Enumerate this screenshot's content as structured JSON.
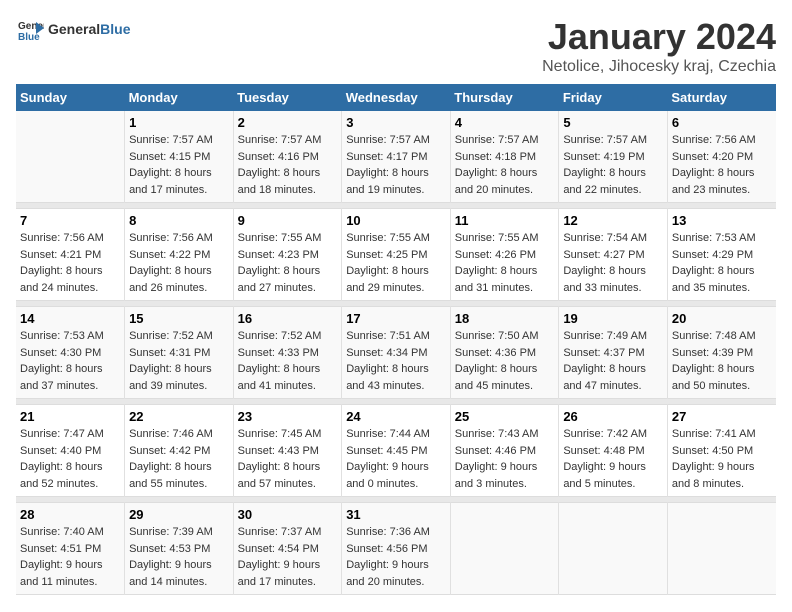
{
  "header": {
    "logo_general": "General",
    "logo_blue": "Blue",
    "title": "January 2024",
    "subtitle": "Netolice, Jihocesky kraj, Czechia"
  },
  "days_of_week": [
    "Sunday",
    "Monday",
    "Tuesday",
    "Wednesday",
    "Thursday",
    "Friday",
    "Saturday"
  ],
  "weeks": [
    [
      {
        "day": "",
        "info": ""
      },
      {
        "day": "1",
        "info": "Sunrise: 7:57 AM\nSunset: 4:15 PM\nDaylight: 8 hours\nand 17 minutes."
      },
      {
        "day": "2",
        "info": "Sunrise: 7:57 AM\nSunset: 4:16 PM\nDaylight: 8 hours\nand 18 minutes."
      },
      {
        "day": "3",
        "info": "Sunrise: 7:57 AM\nSunset: 4:17 PM\nDaylight: 8 hours\nand 19 minutes."
      },
      {
        "day": "4",
        "info": "Sunrise: 7:57 AM\nSunset: 4:18 PM\nDaylight: 8 hours\nand 20 minutes."
      },
      {
        "day": "5",
        "info": "Sunrise: 7:57 AM\nSunset: 4:19 PM\nDaylight: 8 hours\nand 22 minutes."
      },
      {
        "day": "6",
        "info": "Sunrise: 7:56 AM\nSunset: 4:20 PM\nDaylight: 8 hours\nand 23 minutes."
      }
    ],
    [
      {
        "day": "7",
        "info": "Sunrise: 7:56 AM\nSunset: 4:21 PM\nDaylight: 8 hours\nand 24 minutes."
      },
      {
        "day": "8",
        "info": "Sunrise: 7:56 AM\nSunset: 4:22 PM\nDaylight: 8 hours\nand 26 minutes."
      },
      {
        "day": "9",
        "info": "Sunrise: 7:55 AM\nSunset: 4:23 PM\nDaylight: 8 hours\nand 27 minutes."
      },
      {
        "day": "10",
        "info": "Sunrise: 7:55 AM\nSunset: 4:25 PM\nDaylight: 8 hours\nand 29 minutes."
      },
      {
        "day": "11",
        "info": "Sunrise: 7:55 AM\nSunset: 4:26 PM\nDaylight: 8 hours\nand 31 minutes."
      },
      {
        "day": "12",
        "info": "Sunrise: 7:54 AM\nSunset: 4:27 PM\nDaylight: 8 hours\nand 33 minutes."
      },
      {
        "day": "13",
        "info": "Sunrise: 7:53 AM\nSunset: 4:29 PM\nDaylight: 8 hours\nand 35 minutes."
      }
    ],
    [
      {
        "day": "14",
        "info": "Sunrise: 7:53 AM\nSunset: 4:30 PM\nDaylight: 8 hours\nand 37 minutes."
      },
      {
        "day": "15",
        "info": "Sunrise: 7:52 AM\nSunset: 4:31 PM\nDaylight: 8 hours\nand 39 minutes."
      },
      {
        "day": "16",
        "info": "Sunrise: 7:52 AM\nSunset: 4:33 PM\nDaylight: 8 hours\nand 41 minutes."
      },
      {
        "day": "17",
        "info": "Sunrise: 7:51 AM\nSunset: 4:34 PM\nDaylight: 8 hours\nand 43 minutes."
      },
      {
        "day": "18",
        "info": "Sunrise: 7:50 AM\nSunset: 4:36 PM\nDaylight: 8 hours\nand 45 minutes."
      },
      {
        "day": "19",
        "info": "Sunrise: 7:49 AM\nSunset: 4:37 PM\nDaylight: 8 hours\nand 47 minutes."
      },
      {
        "day": "20",
        "info": "Sunrise: 7:48 AM\nSunset: 4:39 PM\nDaylight: 8 hours\nand 50 minutes."
      }
    ],
    [
      {
        "day": "21",
        "info": "Sunrise: 7:47 AM\nSunset: 4:40 PM\nDaylight: 8 hours\nand 52 minutes."
      },
      {
        "day": "22",
        "info": "Sunrise: 7:46 AM\nSunset: 4:42 PM\nDaylight: 8 hours\nand 55 minutes."
      },
      {
        "day": "23",
        "info": "Sunrise: 7:45 AM\nSunset: 4:43 PM\nDaylight: 8 hours\nand 57 minutes."
      },
      {
        "day": "24",
        "info": "Sunrise: 7:44 AM\nSunset: 4:45 PM\nDaylight: 9 hours\nand 0 minutes."
      },
      {
        "day": "25",
        "info": "Sunrise: 7:43 AM\nSunset: 4:46 PM\nDaylight: 9 hours\nand 3 minutes."
      },
      {
        "day": "26",
        "info": "Sunrise: 7:42 AM\nSunset: 4:48 PM\nDaylight: 9 hours\nand 5 minutes."
      },
      {
        "day": "27",
        "info": "Sunrise: 7:41 AM\nSunset: 4:50 PM\nDaylight: 9 hours\nand 8 minutes."
      }
    ],
    [
      {
        "day": "28",
        "info": "Sunrise: 7:40 AM\nSunset: 4:51 PM\nDaylight: 9 hours\nand 11 minutes."
      },
      {
        "day": "29",
        "info": "Sunrise: 7:39 AM\nSunset: 4:53 PM\nDaylight: 9 hours\nand 14 minutes."
      },
      {
        "day": "30",
        "info": "Sunrise: 7:37 AM\nSunset: 4:54 PM\nDaylight: 9 hours\nand 17 minutes."
      },
      {
        "day": "31",
        "info": "Sunrise: 7:36 AM\nSunset: 4:56 PM\nDaylight: 9 hours\nand 20 minutes."
      },
      {
        "day": "",
        "info": ""
      },
      {
        "day": "",
        "info": ""
      },
      {
        "day": "",
        "info": ""
      }
    ]
  ]
}
